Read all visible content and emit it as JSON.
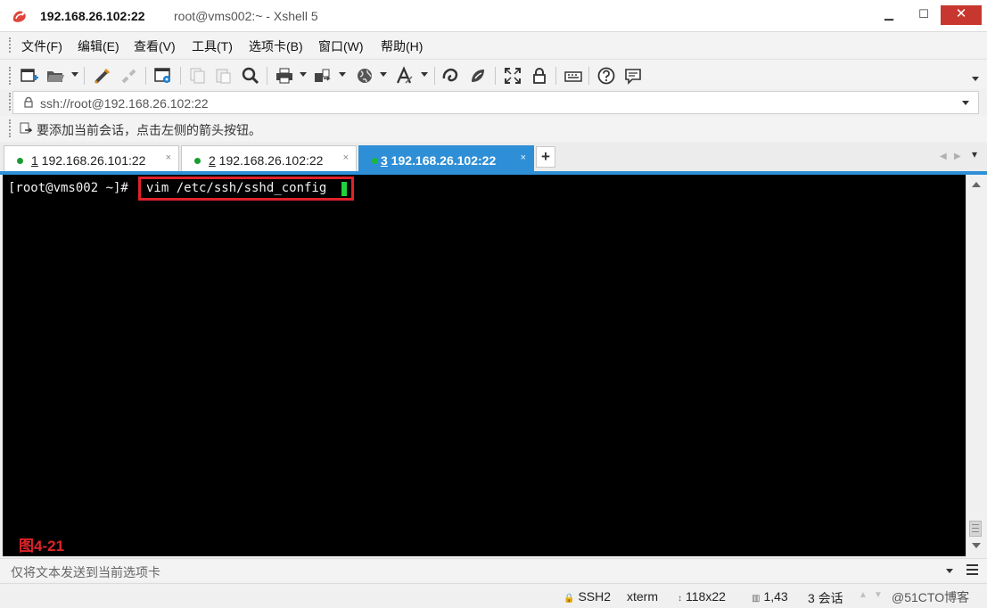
{
  "window": {
    "title_host": "192.168.26.102:22",
    "title_rest": "root@vms002:~ - Xshell 5",
    "minimize": "▁",
    "maximize": "☐",
    "close": "✕"
  },
  "menu": [
    "文件(F)",
    "编辑(E)",
    "查看(V)",
    "工具(T)",
    "选项卡(B)",
    "窗口(W)",
    "帮助(H)"
  ],
  "toolbar": {
    "icons": [
      "new-session-icon",
      "open-folder-icon",
      "connect-icon",
      "disconnect-icon",
      "properties-icon",
      "copy-icon",
      "paste-icon",
      "find-icon",
      "print-icon",
      "transfer-icon",
      "globe-icon",
      "font-icon",
      "xftp-icon",
      "xmanager-icon",
      "fullscreen-icon",
      "lock-icon",
      "keyboard-icon",
      "help-icon",
      "chat-icon"
    ]
  },
  "address": {
    "value": "ssh://root@192.168.26.102:22"
  },
  "hint": {
    "text": "要添加当前会话，点击左侧的箭头按钮。"
  },
  "tabs": [
    {
      "num": "1",
      "label": " 192.168.26.101:22",
      "close": "×"
    },
    {
      "num": "2",
      "label": " 192.168.26.102:22",
      "close": "×"
    },
    {
      "num": "3",
      "label": " 192.168.26.102:22",
      "close": "×"
    }
  ],
  "tab_add": "+",
  "tab_nav": {
    "prev": "◀",
    "next": "▶"
  },
  "terminal": {
    "prompt": "[root@vms002 ~]#",
    "command": "vim /etc/ssh/sshd_config",
    "figure_label": "图4-21",
    "cursor_color": "#1fd13a",
    "highlight_color": "#e0222a"
  },
  "sendbar": {
    "text": "仅将文本发送到当前选项卡"
  },
  "status": {
    "protocol_icon": "🔒",
    "protocol": "SSH2",
    "terminal_type": "xterm",
    "size_icon": "↕",
    "size": "118x22",
    "pos_icon": "▥",
    "position": "1,43",
    "sessions": "3 会话",
    "up": "▲",
    "down": "▼",
    "watermark": "@51CTO博客"
  },
  "colors": {
    "accent": "#2e8fd6",
    "close_button": "#c7372f",
    "terminal_bg": "#000000"
  }
}
